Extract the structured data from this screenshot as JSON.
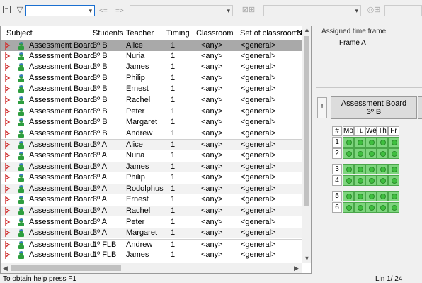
{
  "toolbar": {
    "filter_value": "",
    "nav_prev": "<=",
    "nav_next": "=>",
    "combo2_value": "",
    "combo3_value": ""
  },
  "grid": {
    "columns": [
      "Subject",
      "Students",
      "Teacher",
      "Timing",
      "Classroom",
      "Set of classrooms",
      "N"
    ],
    "rows": [
      {
        "subject": "Assessment Board",
        "students": "3º B",
        "teacher": "Alice",
        "timing": "1",
        "classroom": "<any>",
        "set": "<general>"
      },
      {
        "subject": "Assessment Board",
        "students": "3º B",
        "teacher": "Nuria",
        "timing": "1",
        "classroom": "<any>",
        "set": "<general>"
      },
      {
        "subject": "Assessment Board",
        "students": "3º B",
        "teacher": "James",
        "timing": "1",
        "classroom": "<any>",
        "set": "<general>"
      },
      {
        "subject": "Assessment Board",
        "students": "3º B",
        "teacher": "Philip",
        "timing": "1",
        "classroom": "<any>",
        "set": "<general>"
      },
      {
        "subject": "Assessment Board",
        "students": "3º B",
        "teacher": "Ernest",
        "timing": "1",
        "classroom": "<any>",
        "set": "<general>"
      },
      {
        "subject": "Assessment Board",
        "students": "3º B",
        "teacher": "Rachel",
        "timing": "1",
        "classroom": "<any>",
        "set": "<general>"
      },
      {
        "subject": "Assessment Board",
        "students": "3º B",
        "teacher": "Peter",
        "timing": "1",
        "classroom": "<any>",
        "set": "<general>"
      },
      {
        "subject": "Assessment Board",
        "students": "3º B",
        "teacher": "Margaret",
        "timing": "1",
        "classroom": "<any>",
        "set": "<general>"
      },
      {
        "subject": "Assessment Board",
        "students": "3º B",
        "teacher": "Andrew",
        "timing": "1",
        "classroom": "<any>",
        "set": "<general>"
      },
      {
        "subject": "Assessment Board",
        "students": "3º A",
        "teacher": "Alice",
        "timing": "1",
        "classroom": "<any>",
        "set": "<general>"
      },
      {
        "subject": "Assessment Board",
        "students": "3º A",
        "teacher": "Nuria",
        "timing": "1",
        "classroom": "<any>",
        "set": "<general>"
      },
      {
        "subject": "Assessment Board",
        "students": "3º A",
        "teacher": "James",
        "timing": "1",
        "classroom": "<any>",
        "set": "<general>"
      },
      {
        "subject": "Assessment Board",
        "students": "3º A",
        "teacher": "Philip",
        "timing": "1",
        "classroom": "<any>",
        "set": "<general>"
      },
      {
        "subject": "Assessment Board",
        "students": "3º A",
        "teacher": "Rodolphus",
        "timing": "1",
        "classroom": "<any>",
        "set": "<general>"
      },
      {
        "subject": "Assessment Board",
        "students": "3º A",
        "teacher": "Ernest",
        "timing": "1",
        "classroom": "<any>",
        "set": "<general>"
      },
      {
        "subject": "Assessment Board",
        "students": "3º A",
        "teacher": "Rachel",
        "timing": "1",
        "classroom": "<any>",
        "set": "<general>"
      },
      {
        "subject": "Assessment Board",
        "students": "3º A",
        "teacher": "Peter",
        "timing": "1",
        "classroom": "<any>",
        "set": "<general>"
      },
      {
        "subject": "Assessment Board",
        "students": "3º A",
        "teacher": "Margaret",
        "timing": "1",
        "classroom": "<any>",
        "set": "<general>"
      },
      {
        "subject": "Assessment Board",
        "students": "1º FLB",
        "teacher": "Andrew",
        "timing": "1",
        "classroom": "<any>",
        "set": "<general>"
      },
      {
        "subject": "Assessment Board",
        "students": "1º FLB",
        "teacher": "James",
        "timing": "1",
        "classroom": "<any>",
        "set": "<general>"
      }
    ]
  },
  "right_panel": {
    "assigned_title": "Assigned time frame",
    "frame_value": "Frame A",
    "exclaim": "!",
    "card_line1": "Assessment Board",
    "card_line2": "3º B",
    "hash": "#",
    "days": [
      "Mo",
      "Tu",
      "We",
      "Th",
      "Fr"
    ],
    "periods": [
      "1",
      "2",
      "3",
      "4",
      "5",
      "6"
    ]
  },
  "status": {
    "help": "To obtain help press F1",
    "position": "Lin 1/ 24"
  },
  "colors": {
    "selected_row": "#a9a9a9",
    "cell_green": "#7ed57e",
    "marker_red": "#d03030"
  }
}
